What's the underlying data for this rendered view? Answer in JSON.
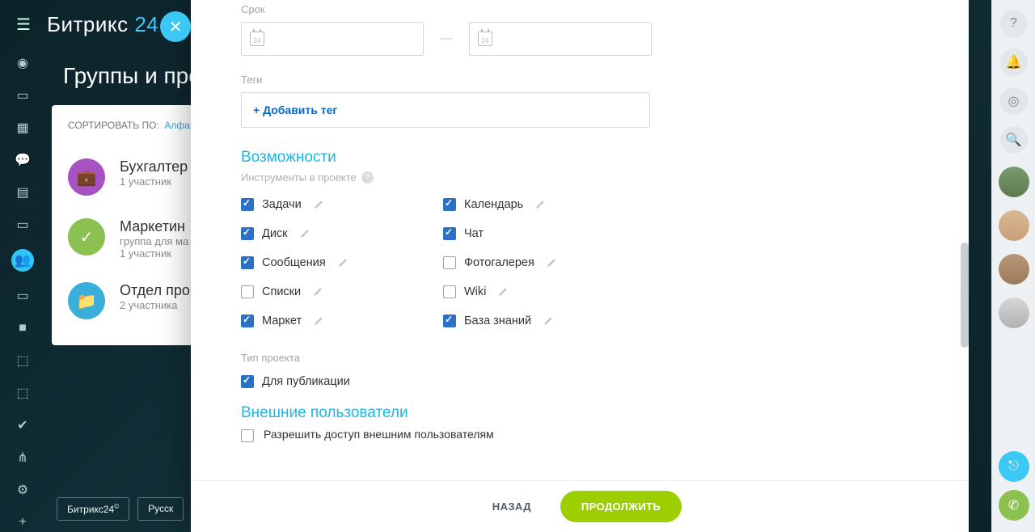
{
  "logo": {
    "part1": "Битрикс",
    "part2": " 24"
  },
  "page_title": "Группы и про",
  "sort": {
    "label": "СОРТИРОВАТЬ ПО:",
    "value": "Алфав"
  },
  "groups": [
    {
      "name": "Бухгалтер",
      "meta": "1 участник"
    },
    {
      "name": "Маркетин",
      "desc": "группа для ма",
      "meta": "1 участник"
    },
    {
      "name": "Отдел про",
      "meta": "2 участника"
    }
  ],
  "footer_chips": [
    "Битрикс24",
    "Русск"
  ],
  "form": {
    "deadline_label": "Срок",
    "tags_label": "Теги",
    "add_tag": "+ Добавить тег",
    "capabilities_title": "Возможности",
    "capabilities_sub": "Инструменты в проекте",
    "options": [
      {
        "label": "Задачи",
        "checked": true,
        "edit": true
      },
      {
        "label": "Календарь",
        "checked": true,
        "edit": true
      },
      {
        "label": "Диск",
        "checked": true,
        "edit": true
      },
      {
        "label": "Чат",
        "checked": true,
        "edit": false
      },
      {
        "label": "Сообщения",
        "checked": true,
        "edit": true
      },
      {
        "label": "Фотогалерея",
        "checked": false,
        "edit": true
      },
      {
        "label": "Списки",
        "checked": false,
        "edit": true
      },
      {
        "label": "Wiki",
        "checked": false,
        "edit": true
      },
      {
        "label": "Маркет",
        "checked": true,
        "edit": true
      },
      {
        "label": "База знаний",
        "checked": true,
        "edit": true
      }
    ],
    "type_label": "Тип проекта",
    "publication": {
      "label": "Для публикации",
      "checked": true
    },
    "external_title": "Внешние пользователи",
    "external_allow": {
      "label": "Разрешить доступ внешним пользователям",
      "checked": false
    }
  },
  "buttons": {
    "back": "НАЗАД",
    "next": "ПРОДОЛЖИТЬ"
  },
  "cal_day": "24"
}
